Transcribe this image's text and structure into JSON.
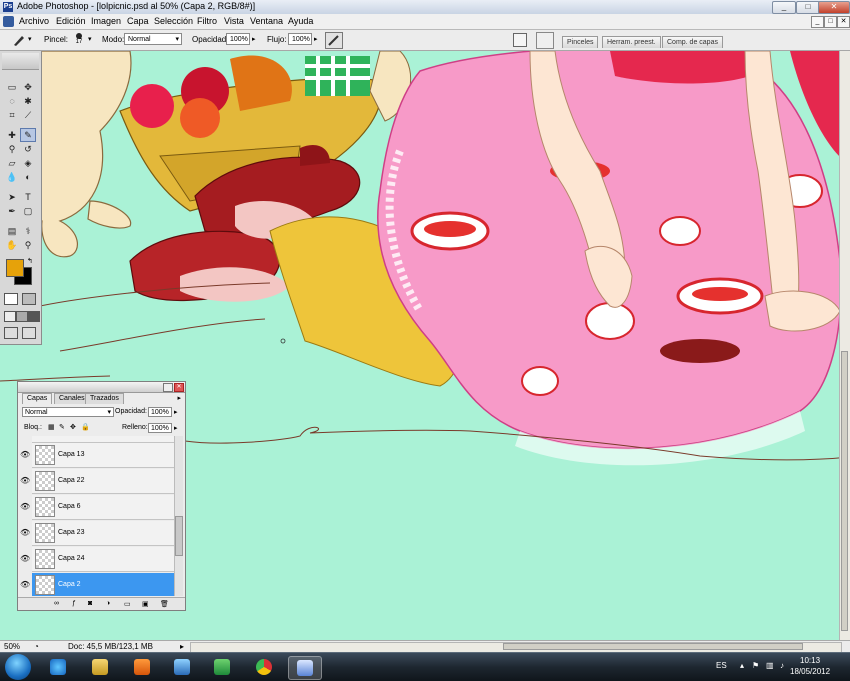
{
  "window": {
    "title": "Adobe Photoshop - [lolpicnic.psd al 50% (Capa 2, RGB/8#)]",
    "app_icon": "photoshop-icon",
    "controls": {
      "minimize": "_",
      "maximize": "□",
      "close": "✕"
    }
  },
  "menu": {
    "items": [
      "Archivo",
      "Edición",
      "Imagen",
      "Capa",
      "Selección",
      "Filtro",
      "Vista",
      "Ventana",
      "Ayuda"
    ],
    "doc_controls": [
      "_",
      "□",
      "✕"
    ]
  },
  "options": {
    "tool_icon": "brush-icon",
    "brush_label": "Pincel:",
    "brush_size": "17",
    "mode_label": "Modo:",
    "mode_value": "Normal",
    "opacity_label": "Opacidad:",
    "opacity_value": "100%",
    "flow_label": "Flujo:",
    "flow_value": "100%",
    "palette_tabs": [
      "Pinceles",
      "Herram. preest.",
      "Comp. de capas"
    ]
  },
  "toolbox": {
    "foreground_color": "#e6a20a",
    "background_color": "#000000",
    "tools": [
      "move-icon",
      "marquee-icon",
      "lasso-icon",
      "magic-wand-icon",
      "crop-icon",
      "slice-icon",
      "healing-icon",
      "brush-icon",
      "stamp-icon",
      "history-brush-icon",
      "eraser-icon",
      "bucket-icon",
      "blur-icon",
      "dodge-icon",
      "path-select-icon",
      "type-icon",
      "pen-icon",
      "shape-icon",
      "notes-icon",
      "eyedropper-icon",
      "hand-icon",
      "zoom-icon"
    ]
  },
  "layers_panel": {
    "tabs": [
      "Capas",
      "Canales",
      "Trazados"
    ],
    "blend_mode": "Normal",
    "opacity_label": "Opacidad:",
    "opacity_value": "100%",
    "lock_label": "Bloq.:",
    "fill_label": "Relleno:",
    "fill_value": "100%",
    "layers": [
      {
        "name": "Capa 13",
        "selected": false
      },
      {
        "name": "Capa 22",
        "selected": false
      },
      {
        "name": "Capa 6",
        "selected": false
      },
      {
        "name": "Capa 23",
        "selected": false
      },
      {
        "name": "Capa 24",
        "selected": false
      },
      {
        "name": "Capa 2",
        "selected": true
      }
    ]
  },
  "status": {
    "zoom": "50%",
    "doc_info": "Doc: 45,5 MB/123,1 MB"
  },
  "taskbar": {
    "language": "ES",
    "time": "10:13",
    "date": "18/05/2012",
    "apps": [
      "ie-icon",
      "explorer-icon",
      "media-player-icon",
      "paint-icon",
      "messenger-icon",
      "chrome-icon",
      "photoshop-feather-icon"
    ]
  },
  "colors": {
    "canvas_bg": "#aaf2d6",
    "selected_layer": "#3c97f0",
    "dress_pink": "#f79ac8"
  }
}
